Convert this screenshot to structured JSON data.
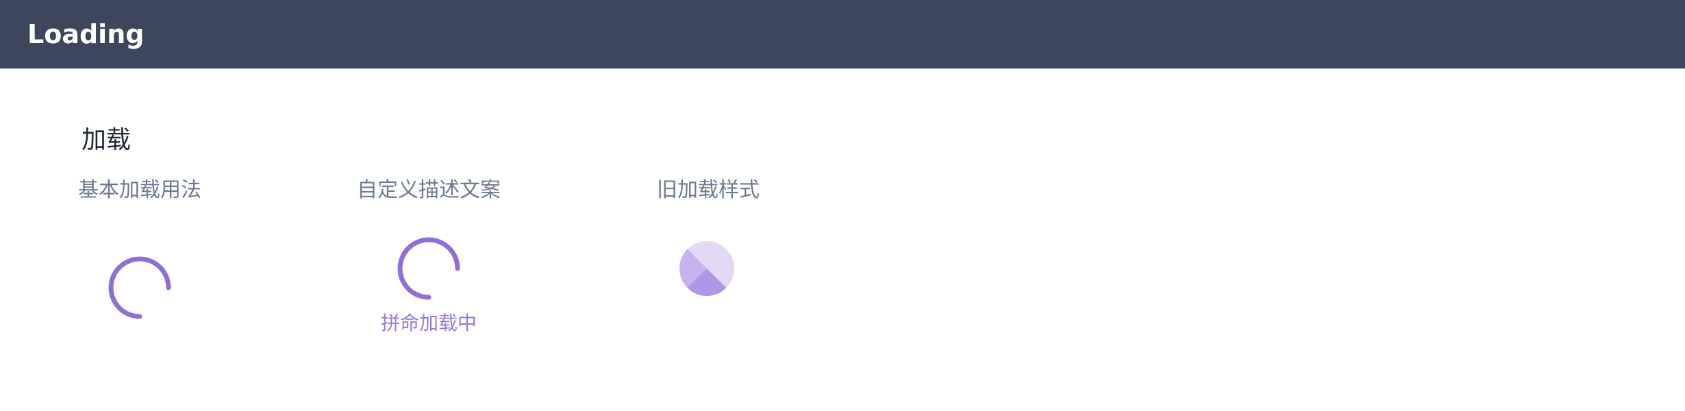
{
  "header": {
    "title": "Loading"
  },
  "section": {
    "title": "加载"
  },
  "examples": [
    {
      "label": "基本加载用法",
      "spinner_icon": "spinner-arc-icon"
    },
    {
      "label": "自定义描述文案",
      "spinner_icon": "spinner-arc-icon",
      "caption": "拼命加载中"
    },
    {
      "label": "旧加载样式",
      "spinner_icon": "pie-spinner-icon"
    }
  ],
  "colors": {
    "header_bg": "#3c475e",
    "accent": "#8f6fd6",
    "accent_light": "#e2d9f6",
    "accent_mid": "#c6b3ee",
    "label": "#6b7a90",
    "caption": "#9a7ad8"
  }
}
